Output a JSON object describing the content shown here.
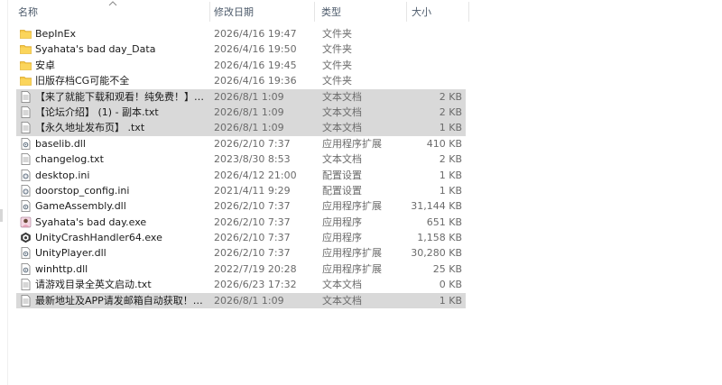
{
  "header": {
    "name": "名称",
    "date": "修改日期",
    "type": "类型",
    "size": "大小"
  },
  "files": [
    {
      "name": "BepInEx",
      "date": "2026/4/16 19:47",
      "type": "文件夹",
      "size": "",
      "icon": "folder-icon",
      "selected": false
    },
    {
      "name": "Syahata's bad day_Data",
      "date": "2026/4/16 19:50",
      "type": "文件夹",
      "size": "",
      "icon": "folder-icon",
      "selected": false
    },
    {
      "name": "安卓",
      "date": "2026/4/16 19:45",
      "type": "文件夹",
      "size": "",
      "icon": "folder-icon",
      "selected": false
    },
    {
      "name": "旧版存档CG可能不全",
      "date": "2026/4/16 19:36",
      "type": "文件夹",
      "size": "",
      "icon": "folder-icon",
      "selected": false
    },
    {
      "name": "【来了就能下载和观看！纯免费！】 - 副...",
      "date": "2026/8/1 1:09",
      "type": "文本文档",
      "size": "2 KB",
      "icon": "text-file-icon",
      "selected": true
    },
    {
      "name": "【论坛介绍】 (1) - 副本.txt",
      "date": "2026/8/1 1:09",
      "type": "文本文档",
      "size": "2 KB",
      "icon": "text-file-icon",
      "selected": true
    },
    {
      "name": "【永久地址发布页】 .txt",
      "date": "2026/8/1 1:09",
      "type": "文本文档",
      "size": "1 KB",
      "icon": "text-file-icon",
      "selected": true
    },
    {
      "name": "baselib.dll",
      "date": "2026/2/10 7:37",
      "type": "应用程序扩展",
      "size": "410 KB",
      "icon": "dll-file-icon",
      "selected": false
    },
    {
      "name": "changelog.txt",
      "date": "2023/8/30 8:53",
      "type": "文本文档",
      "size": "2 KB",
      "icon": "text-file-icon",
      "selected": false
    },
    {
      "name": "desktop.ini",
      "date": "2026/4/12 21:00",
      "type": "配置设置",
      "size": "1 KB",
      "icon": "ini-file-icon",
      "selected": false
    },
    {
      "name": "doorstop_config.ini",
      "date": "2021/4/11 9:29",
      "type": "配置设置",
      "size": "1 KB",
      "icon": "ini-file-icon",
      "selected": false
    },
    {
      "name": "GameAssembly.dll",
      "date": "2026/2/10 7:37",
      "type": "应用程序扩展",
      "size": "31,144 KB",
      "icon": "dll-file-icon",
      "selected": false
    },
    {
      "name": "Syahata's bad day.exe",
      "date": "2026/2/10 7:37",
      "type": "应用程序",
      "size": "651 KB",
      "icon": "game-exe-icon",
      "selected": false
    },
    {
      "name": "UnityCrashHandler64.exe",
      "date": "2026/2/10 7:37",
      "type": "应用程序",
      "size": "1,158 KB",
      "icon": "unity-exe-icon",
      "selected": false
    },
    {
      "name": "UnityPlayer.dll",
      "date": "2026/2/10 7:37",
      "type": "应用程序扩展",
      "size": "30,280 KB",
      "icon": "dll-file-icon",
      "selected": false
    },
    {
      "name": "winhttp.dll",
      "date": "2022/7/19 20:28",
      "type": "应用程序扩展",
      "size": "25 KB",
      "icon": "dll-file-icon",
      "selected": false
    },
    {
      "name": "请游戏目录全英文启动.txt",
      "date": "2026/6/23 17:32",
      "type": "文本文档",
      "size": "0 KB",
      "icon": "text-file-icon",
      "selected": false
    },
    {
      "name": "最新地址及APP请发邮箱自动获取！！！...",
      "date": "2026/8/1 1:09",
      "type": "文本文档",
      "size": "1 KB",
      "icon": "text-file-icon",
      "selected": true
    }
  ]
}
